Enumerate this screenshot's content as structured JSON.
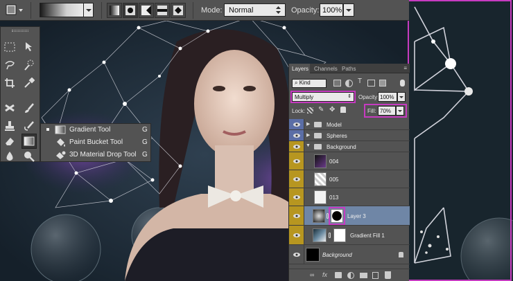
{
  "options_bar": {
    "mode_label": "Mode:",
    "mode_value": "Normal",
    "opacity_label": "Opacity:",
    "opacity_value": "100%"
  },
  "tool_flyout": {
    "items": [
      {
        "label": "Gradient Tool",
        "key": "G",
        "selected": true
      },
      {
        "label": "Paint Bucket Tool",
        "key": "G",
        "selected": false
      },
      {
        "label": "3D Material Drop Tool",
        "key": "G",
        "selected": false
      }
    ]
  },
  "layers_panel": {
    "tabs": [
      "Layers",
      "Channels",
      "Paths"
    ],
    "filter_kind": "Kind",
    "blend_mode": "Multiply",
    "opacity_label": "Opacity:",
    "opacity_value": "100%",
    "lock_label": "Lock:",
    "fill_label": "Fill:",
    "fill_value": "70%",
    "layers": [
      {
        "name": "Model",
        "type": "group",
        "expanded": false,
        "eye_color": "#5b6ea6"
      },
      {
        "name": "Spheres",
        "type": "group",
        "expanded": false,
        "eye_color": "#5b6ea6"
      },
      {
        "name": "Background",
        "type": "group",
        "expanded": true,
        "eye_color": "#b79620"
      },
      {
        "name": "004",
        "type": "layer",
        "eye_color": "#b79620"
      },
      {
        "name": "005",
        "type": "layer",
        "eye_color": "#b79620"
      },
      {
        "name": "013",
        "type": "layer",
        "eye_color": "#b79620"
      },
      {
        "name": "Layer 3",
        "type": "layer",
        "selected": true,
        "eye_color": "#b79620"
      },
      {
        "name": "Gradient Fill 1",
        "type": "adjustment",
        "eye_color": "#b79620"
      },
      {
        "name": "Background",
        "type": "background",
        "italic": true,
        "eye_color": "#535353"
      }
    ]
  },
  "colors": {
    "highlight": "#c63bc0",
    "panel_bg": "#535353",
    "selected_row": "#6f86a6"
  }
}
